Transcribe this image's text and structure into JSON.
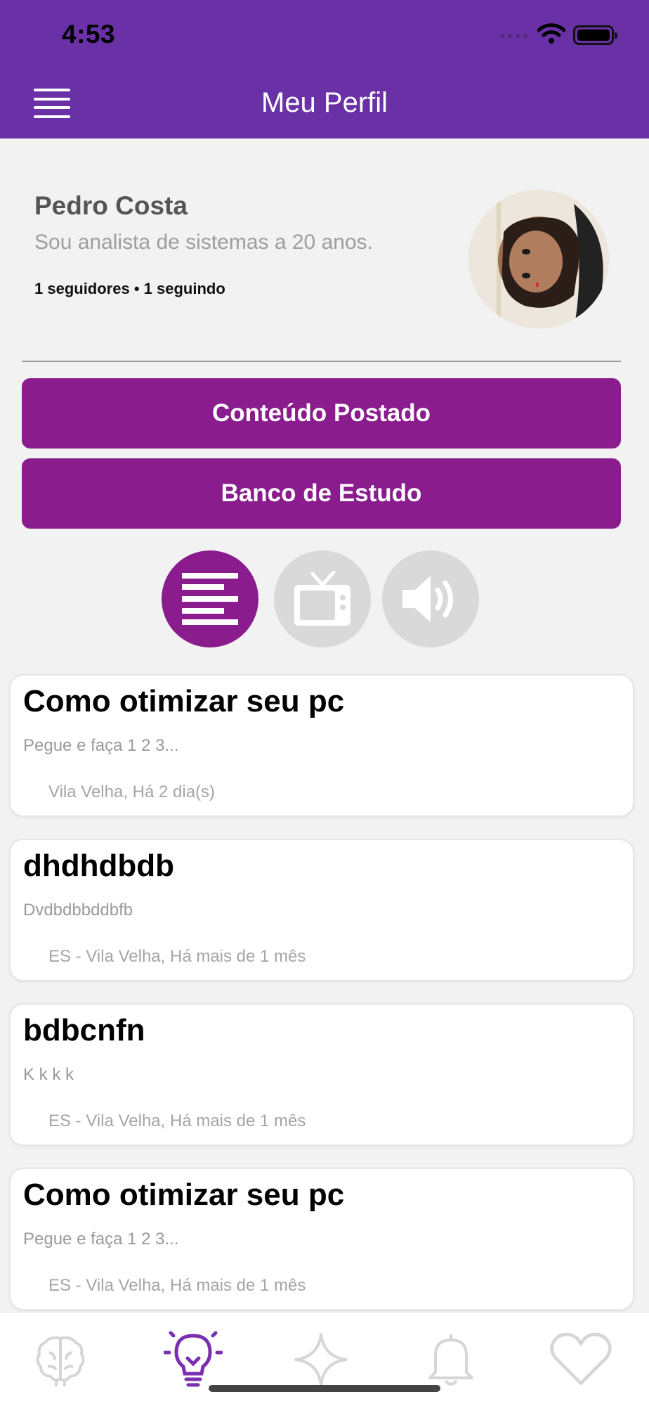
{
  "status_bar": {
    "time": "4:53"
  },
  "header": {
    "title": "Meu Perfil"
  },
  "profile": {
    "name": "Pedro Costa",
    "bio": "Sou analista de sistemas a 20 anos.",
    "stats": "1 seguidores • 1 seguindo"
  },
  "buttons": {
    "posted": "Conteúdo Postado",
    "study_bank": "Banco de Estudo"
  },
  "filters": [
    {
      "icon": "text-lines-icon",
      "active": true
    },
    {
      "icon": "tv-icon",
      "active": false
    },
    {
      "icon": "speaker-icon",
      "active": false
    }
  ],
  "posts": [
    {
      "title": "Como otimizar seu pc",
      "description": "Pegue e faça 1 2 3...",
      "meta": "Vila Velha, Há 2 dia(s)"
    },
    {
      "title": "dhdhdbdb",
      "description": "Dvdbdbbddbfb",
      "meta": "ES - Vila Velha, Há mais de 1 mês"
    },
    {
      "title": "bdbcnfn",
      "description": "K k k k",
      "meta": "ES - Vila Velha, Há mais de 1 mês"
    },
    {
      "title": "Como otimizar seu pc",
      "description": "Pegue e faça 1 2 3...",
      "meta": "ES - Vila Velha, Há mais de 1 mês"
    }
  ],
  "tabbar": [
    {
      "icon": "brain-icon",
      "active": false
    },
    {
      "icon": "lightbulb-icon",
      "active": true
    },
    {
      "icon": "sparkle-icon",
      "active": false
    },
    {
      "icon": "bell-icon",
      "active": false
    },
    {
      "icon": "heart-icon",
      "active": false
    }
  ],
  "colors": {
    "primary": "#6a31a6",
    "accent": "#8a1c8e",
    "inactive": "#d9d9d9"
  }
}
